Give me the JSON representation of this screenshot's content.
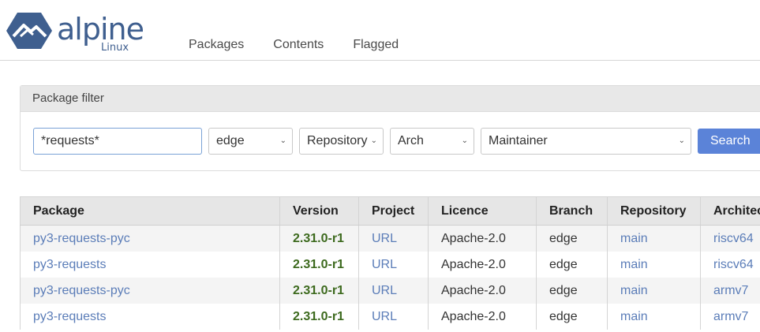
{
  "header": {
    "logo_word": "alpine",
    "logo_sub": "Linux",
    "nav": [
      "Packages",
      "Contents",
      "Flagged"
    ]
  },
  "filter": {
    "title": "Package filter",
    "name_value": "*requests*",
    "branch": "edge",
    "repository": "Repository",
    "arch": "Arch",
    "maintainer": "Maintainer",
    "search_label": "Search"
  },
  "table": {
    "headers": [
      "Package",
      "Version",
      "Project",
      "Licence",
      "Branch",
      "Repository",
      "Architecture"
    ],
    "rows": [
      {
        "package": "py3-requests-pyc",
        "version": "2.31.0-r1",
        "project": "URL",
        "licence": "Apache-2.0",
        "branch": "edge",
        "repository": "main",
        "arch": "riscv64"
      },
      {
        "package": "py3-requests",
        "version": "2.31.0-r1",
        "project": "URL",
        "licence": "Apache-2.0",
        "branch": "edge",
        "repository": "main",
        "arch": "riscv64"
      },
      {
        "package": "py3-requests-pyc",
        "version": "2.31.0-r1",
        "project": "URL",
        "licence": "Apache-2.0",
        "branch": "edge",
        "repository": "main",
        "arch": "armv7"
      },
      {
        "package": "py3-requests",
        "version": "2.31.0-r1",
        "project": "URL",
        "licence": "Apache-2.0",
        "branch": "edge",
        "repository": "main",
        "arch": "armv7"
      }
    ]
  },
  "colors": {
    "accent": "#5b83d8",
    "link": "#5b7db8",
    "version": "#3d6a1e",
    "logo": "#3f5f8f"
  }
}
